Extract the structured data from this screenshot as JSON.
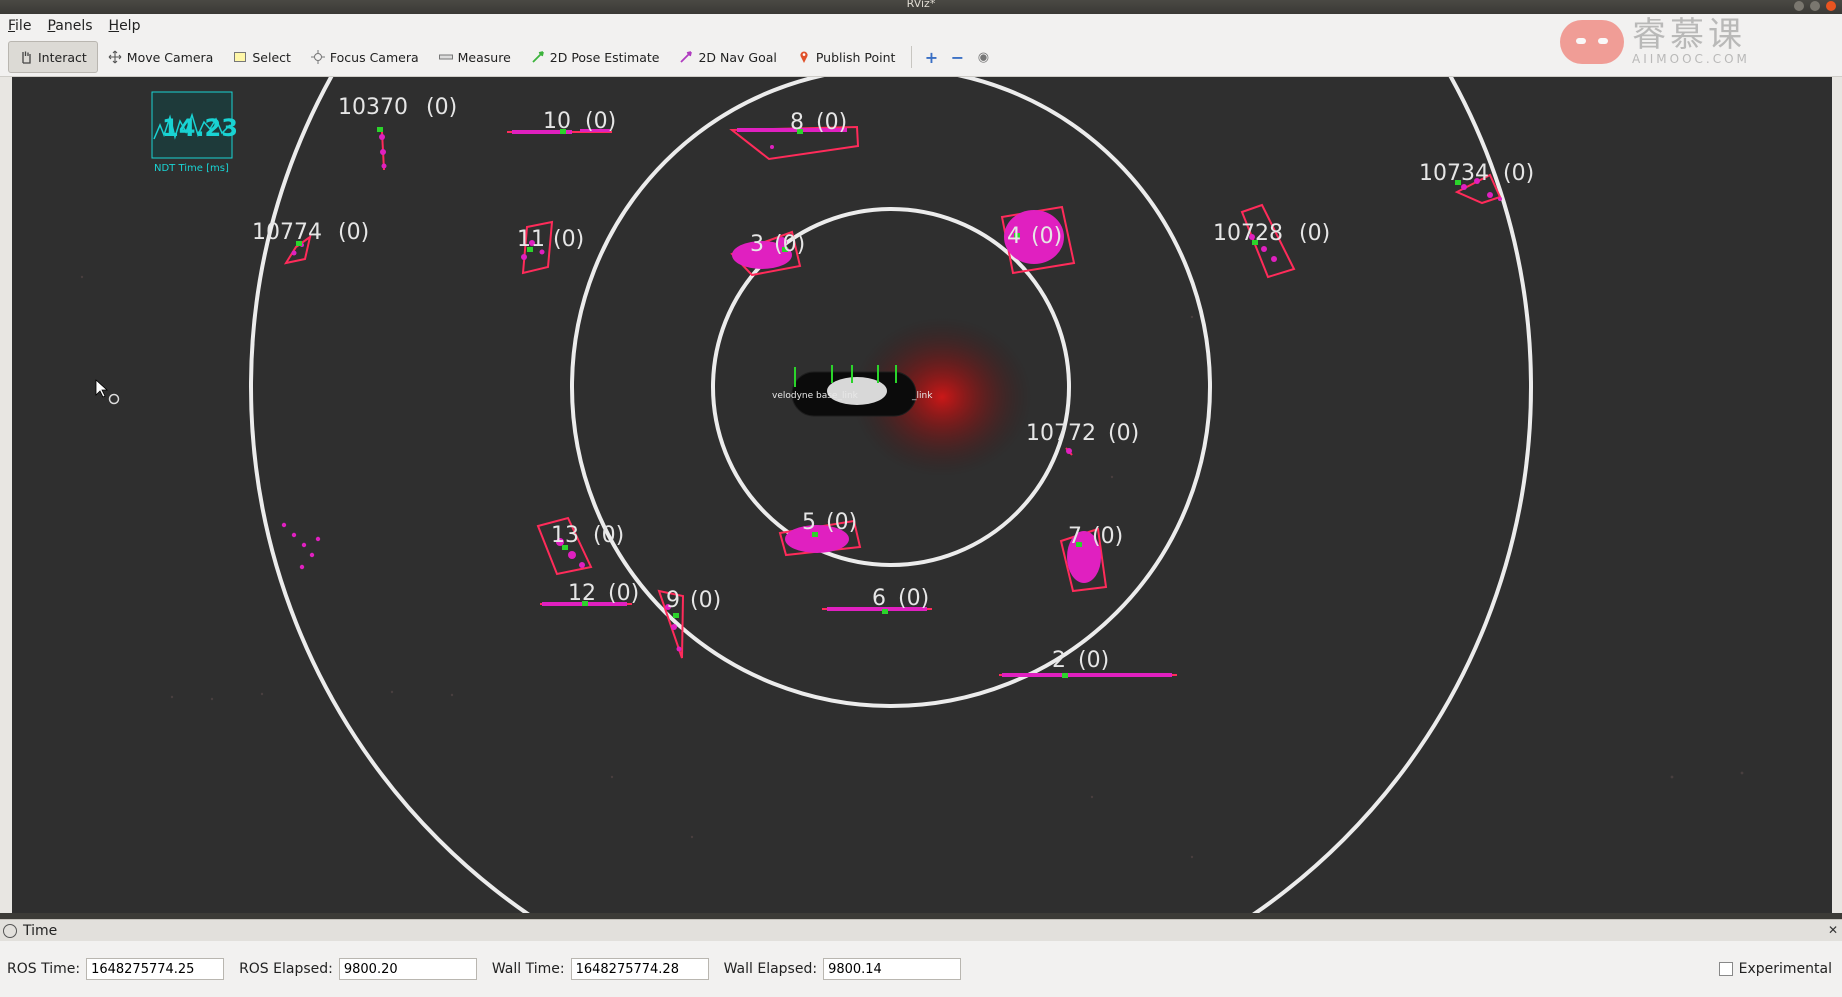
{
  "window": {
    "title": "RViz*"
  },
  "menu": [
    {
      "label": "File",
      "accel": "F",
      "rest": "ile"
    },
    {
      "label": "Panels",
      "accel": "P",
      "rest": "anels"
    },
    {
      "label": "Help",
      "accel": "H",
      "rest": "elp"
    }
  ],
  "toolbar": {
    "tools": [
      {
        "label": "Interact",
        "icon": "hand-icon"
      },
      {
        "label": "Move Camera",
        "icon": "move-camera-icon"
      },
      {
        "label": "Select",
        "icon": "select-icon"
      },
      {
        "label": "Focus Camera",
        "icon": "focus-camera-icon"
      },
      {
        "label": "Measure",
        "icon": "measure-icon"
      },
      {
        "label": "2D Pose Estimate",
        "icon": "pose-arrow-icon"
      },
      {
        "label": "2D Nav Goal",
        "icon": "nav-goal-icon"
      },
      {
        "label": "Publish Point",
        "icon": "map-pin-icon"
      }
    ],
    "extra": [
      "plus-icon",
      "minus-icon",
      "eye-icon"
    ]
  },
  "logo": {
    "cn": "睿慕课",
    "en": "AIIMOOC.COM"
  },
  "ndt_overlay": {
    "value": "14.23",
    "caption": "NDT Time [ms]"
  },
  "vehicle_label": "velodyne base_link",
  "objects": [
    {
      "id": "10370",
      "class": "(0)"
    },
    {
      "id": "10",
      "class": "(0)"
    },
    {
      "id": "8",
      "class": "(0)"
    },
    {
      "id": "10734",
      "class": "(0)"
    },
    {
      "id": "10774",
      "class": "(0)"
    },
    {
      "id": "11",
      "class": "(0)"
    },
    {
      "id": "3",
      "class": "(0)"
    },
    {
      "id": "4",
      "class": "(0)"
    },
    {
      "id": "10728",
      "class": "(0)"
    },
    {
      "id": "10772",
      "class": "(0)"
    },
    {
      "id": "5",
      "class": "(0)"
    },
    {
      "id": "13",
      "class": "(0)"
    },
    {
      "id": "7",
      "class": "(0)"
    },
    {
      "id": "12",
      "class": "(0)"
    },
    {
      "id": "9",
      "class": "(0)"
    },
    {
      "id": "6",
      "class": "(0)"
    },
    {
      "id": "2",
      "class": "(0)"
    }
  ],
  "time_panel": {
    "title": "Time",
    "ros_time_label": "ROS Time:",
    "ros_time": "1648275774.25",
    "ros_elapsed_label": "ROS Elapsed:",
    "ros_elapsed": "9800.20",
    "wall_time_label": "Wall Time:",
    "wall_time": "1648275774.28",
    "wall_elapsed_label": "Wall Elapsed:",
    "wall_elapsed": "9800.14",
    "experimental_label": "Experimental"
  },
  "colors": {
    "accent": "#e95420",
    "viewport_bg": "#2f2f2f",
    "points": "#e020c0",
    "boxes": "#ff2b5a",
    "overlay": "#19d3d3"
  }
}
